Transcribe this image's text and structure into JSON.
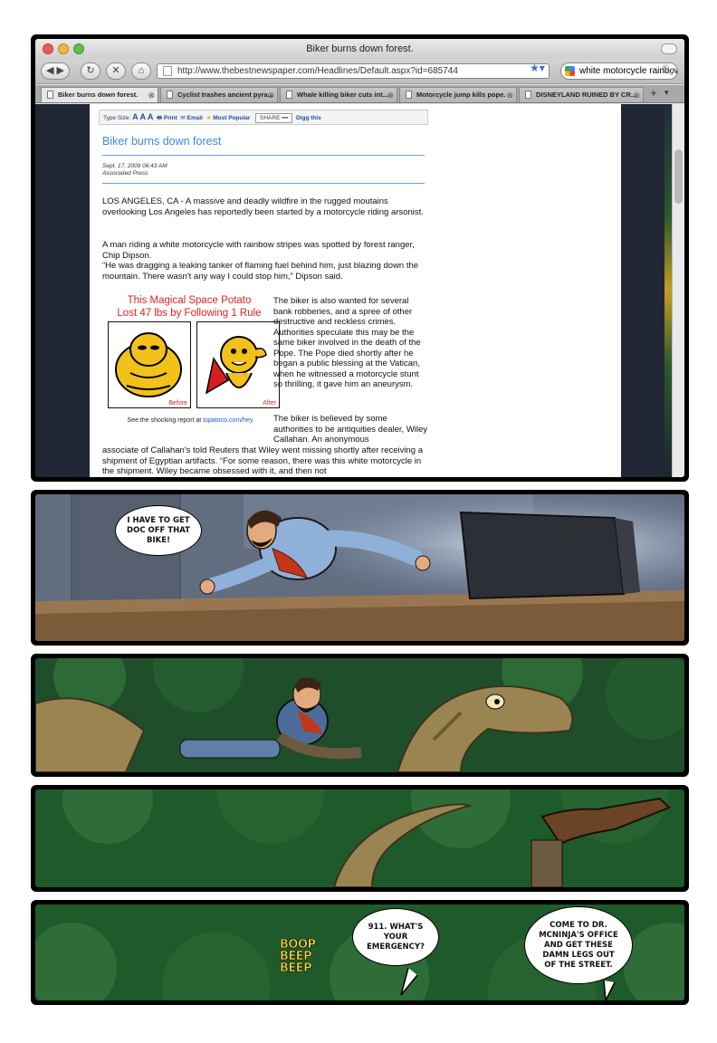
{
  "browser": {
    "window_title": "Biker burns down forest.",
    "url": "http://www.thebestnewspaper.com/Headlines/Default.aspx?id=685744",
    "search_value": "white motorcycle rainbow",
    "tabs": [
      {
        "label": "Biker burns down forest."
      },
      {
        "label": "Cyclist trashes ancient pyra..."
      },
      {
        "label": "Whale killing biker cuts int..."
      },
      {
        "label": "Motorcycle jump kills pope."
      },
      {
        "label": "DISNEYLAND RUINED BY CR..."
      }
    ]
  },
  "article": {
    "toolbar": {
      "type_size": "Type Size:",
      "sizes": "A A A",
      "print": "Print",
      "email": "Email",
      "most_popular": "Most Popular",
      "share": "SHARE",
      "digg": "Digg this"
    },
    "headline": "Biker burns down forest",
    "date": "Sept. 17, 2009 06:43 AM",
    "source": "Associated Press",
    "p1": "LOS ANGELES, CA - A massive and deadly wildfire in the rugged moutains overlooking Los Angeles has reportedly been started by a motorcycle riding arsonist.",
    "p2": "A man riding a white motorcycle with rainbow stripes was spotted by forest ranger, Chip Dipson.",
    "p3": "“He was dragging a leaking tanker of flaming fuel behind him, just blazing down the mountain. There wasn't any way I could stop him,” Dipson said.",
    "p4": "The biker is also wanted for several bank robberies, and a spree of other destructive and reckless crimes. Authorities speculate this may be the same biker involved in the death of the Pope. The Pope died shortly after he began a public blessing at the Vatican, when he witnessed a motorcycle stunt so thrilling, it gave him an aneurysm.",
    "p5": "The biker is believed by some authorities to be antiquities dealer, Wiley Callahan. An anonymous",
    "p6": "associate of Callahan's told Reuters that Wiley went missing shortly after receiving a shipment of Egyptian artifacts. “For some reason, there was this white motorcycle in the shipment. Wiley became obsessed with it, and then not"
  },
  "ad": {
    "headline_1": "This Magical Space Potato",
    "headline_2": "Lost 47 lbs by Following 1 Rule",
    "before": "Before",
    "after": "After",
    "report_text": "See the shocking report at",
    "report_link": "topatoco.com/hey"
  },
  "panel2": {
    "speech": "I have to get Doc off that bike!"
  },
  "panel5": {
    "sfx": [
      "BOOP",
      "BEEP",
      "BEEP"
    ],
    "operator": "911. What's your emergency?",
    "caller": "Come to Dr. McNinja's office and get these damn legs out of the street."
  },
  "colors": {
    "headline_blue": "#3a8bd8",
    "ad_red": "#e02222",
    "link_blue": "#1e5ad8",
    "forest_green": "#1f5a2a",
    "sfx_yellow": "#f0d84a"
  }
}
